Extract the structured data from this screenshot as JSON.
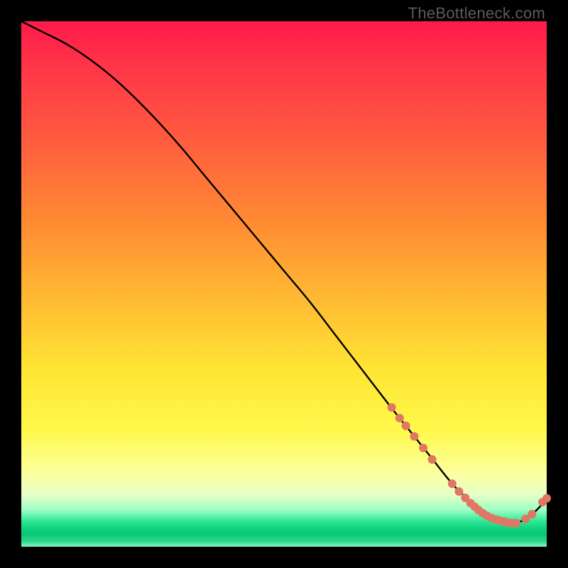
{
  "watermark": "TheBottleneck.com",
  "chart_data": {
    "type": "line",
    "title": "",
    "xlabel": "",
    "ylabel": "",
    "xlim": [
      0,
      100
    ],
    "ylim": [
      0,
      100
    ],
    "grid": false,
    "annotations": [],
    "series": [
      {
        "name": "bottleneck-curve",
        "color": "#000000",
        "x": [
          0,
          4,
          8,
          12,
          16,
          20,
          25,
          30,
          35,
          40,
          45,
          50,
          55,
          60,
          65,
          70,
          74,
          78,
          82,
          85,
          88,
          91,
          94,
          97,
          100
        ],
        "y": [
          100,
          98,
          96,
          93.5,
          90.5,
          87,
          82,
          76.5,
          70.5,
          64.5,
          58.5,
          52.5,
          46.5,
          40,
          33.5,
          27,
          22,
          17,
          12,
          9,
          6.5,
          5,
          4.5,
          6,
          9
        ]
      }
    ],
    "markers": [
      {
        "name": "curve-dots",
        "color": "#e07763",
        "radius": 6,
        "points": [
          {
            "x": 70.5,
            "y": 26.5
          },
          {
            "x": 72.0,
            "y": 24.5
          },
          {
            "x": 73.2,
            "y": 23.0
          },
          {
            "x": 74.8,
            "y": 21.0
          },
          {
            "x": 76.5,
            "y": 18.8
          },
          {
            "x": 78.2,
            "y": 16.6
          },
          {
            "x": 82.0,
            "y": 12.0
          },
          {
            "x": 83.3,
            "y": 10.5
          },
          {
            "x": 84.5,
            "y": 9.3
          },
          {
            "x": 85.5,
            "y": 8.3
          },
          {
            "x": 86.3,
            "y": 7.6
          },
          {
            "x": 87.0,
            "y": 7.0
          },
          {
            "x": 87.8,
            "y": 6.4
          },
          {
            "x": 88.6,
            "y": 5.9
          },
          {
            "x": 89.4,
            "y": 5.5
          },
          {
            "x": 90.2,
            "y": 5.2
          },
          {
            "x": 91.0,
            "y": 5.0
          },
          {
            "x": 91.8,
            "y": 4.8
          },
          {
            "x": 92.6,
            "y": 4.6
          },
          {
            "x": 93.4,
            "y": 4.5
          },
          {
            "x": 94.2,
            "y": 4.5
          },
          {
            "x": 96.0,
            "y": 5.3
          },
          {
            "x": 97.2,
            "y": 6.2
          },
          {
            "x": 99.2,
            "y": 8.5
          },
          {
            "x": 100.0,
            "y": 9.2
          }
        ]
      }
    ]
  }
}
